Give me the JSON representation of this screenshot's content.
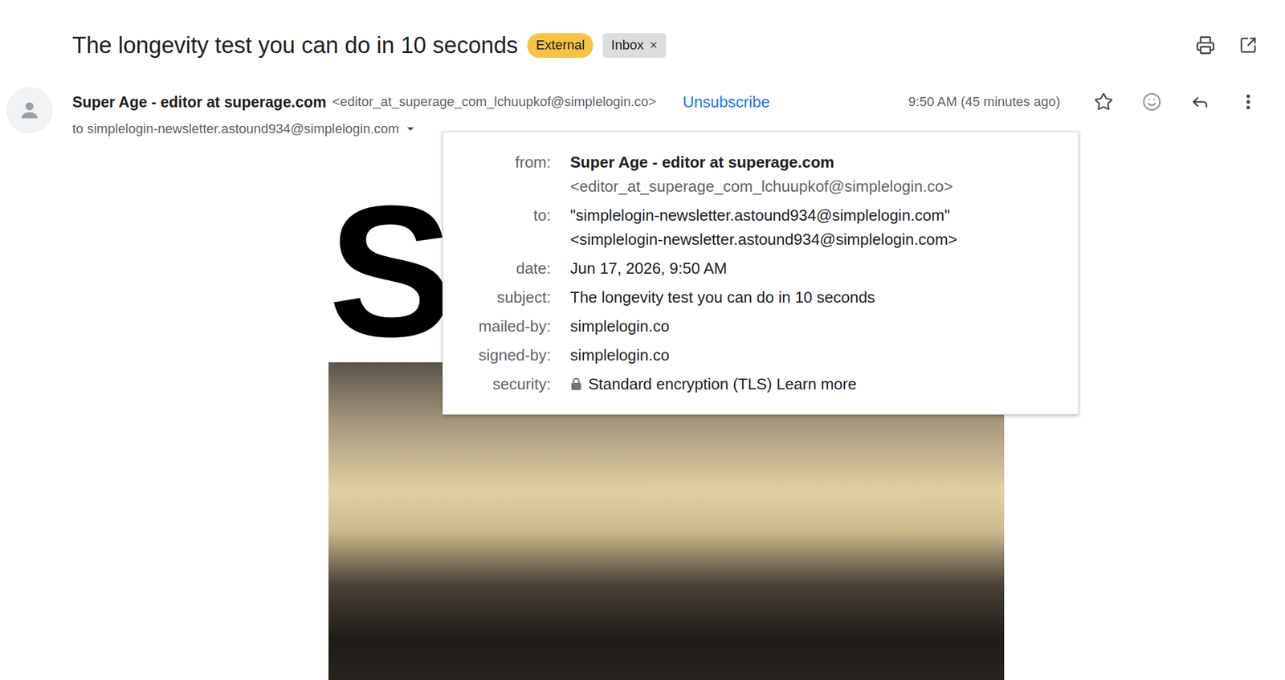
{
  "subject": "The longevity test you can do in 10 seconds",
  "labels": [
    {
      "text": "External",
      "kind": "badge",
      "color": "#f6c344"
    },
    {
      "text": "Inbox",
      "kind": "removable",
      "color": "#dddddd",
      "remove": "×"
    }
  ],
  "message": {
    "sender_name": "Super Age - editor at superage.com",
    "sender_email": "<editor_at_superage_com_lchuupkof@simplelogin.co>",
    "unsubscribe": "Unsubscribe",
    "time": "9:50 AM (45 minutes ago)",
    "starred": false,
    "recipient": "to simplelogin-newsletter.astound934@simplelogin.com",
    "details_expanded": true
  },
  "details": [
    {
      "label": "from:",
      "kind": "sender",
      "lines": [
        "Super Age - editor at superage.com",
        "<editor_at_superage_com_lchuupkof@simplelogin.co>"
      ]
    },
    {
      "label": "to:",
      "kind": "text",
      "lines": [
        "\"simplelogin-newsletter.astound934@simplelogin.com\"",
        "<simplelogin-newsletter.astound934@simplelogin.com>"
      ]
    },
    {
      "label": "date:",
      "kind": "text",
      "lines": [
        "Jun 17, 2026, 9:50 AM"
      ]
    },
    {
      "label": "subject:",
      "kind": "text",
      "lines": [
        "The longevity test you can do in 10 seconds"
      ]
    },
    {
      "label": "mailed-by:",
      "kind": "text",
      "lines": [
        "simplelogin.co"
      ]
    },
    {
      "label": "signed-by:",
      "kind": "text",
      "lines": [
        "simplelogin.co"
      ]
    },
    {
      "label": "security:",
      "kind": "security",
      "lines": [
        "Standard encryption (TLS) Learn more"
      ]
    }
  ],
  "newsletter": {
    "logo": "SU"
  }
}
